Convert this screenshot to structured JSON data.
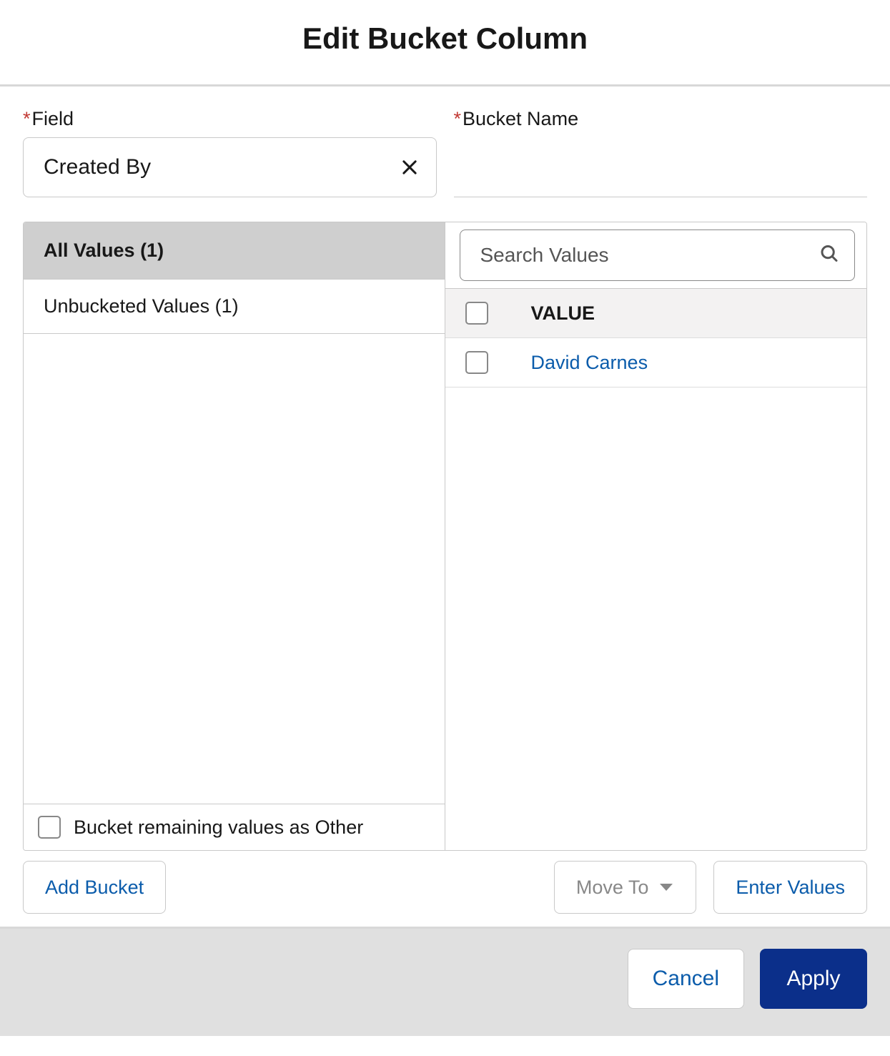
{
  "header": {
    "title": "Edit Bucket Column"
  },
  "fields": {
    "field_label": "Field",
    "field_value": "Created By",
    "bucket_name_label": "Bucket Name",
    "bucket_name_value": ""
  },
  "left_panel": {
    "all_values_label": "All Values (1)",
    "unbucketed_label": "Unbucketed Values (1)",
    "bucket_other_label": "Bucket remaining values as Other"
  },
  "right_panel": {
    "search_placeholder": "Search Values",
    "column_header": "VALUE",
    "values": [
      {
        "label": "David Carnes"
      }
    ]
  },
  "actions": {
    "add_bucket": "Add Bucket",
    "move_to": "Move To",
    "enter_values": "Enter Values"
  },
  "footer": {
    "cancel": "Cancel",
    "apply": "Apply"
  }
}
